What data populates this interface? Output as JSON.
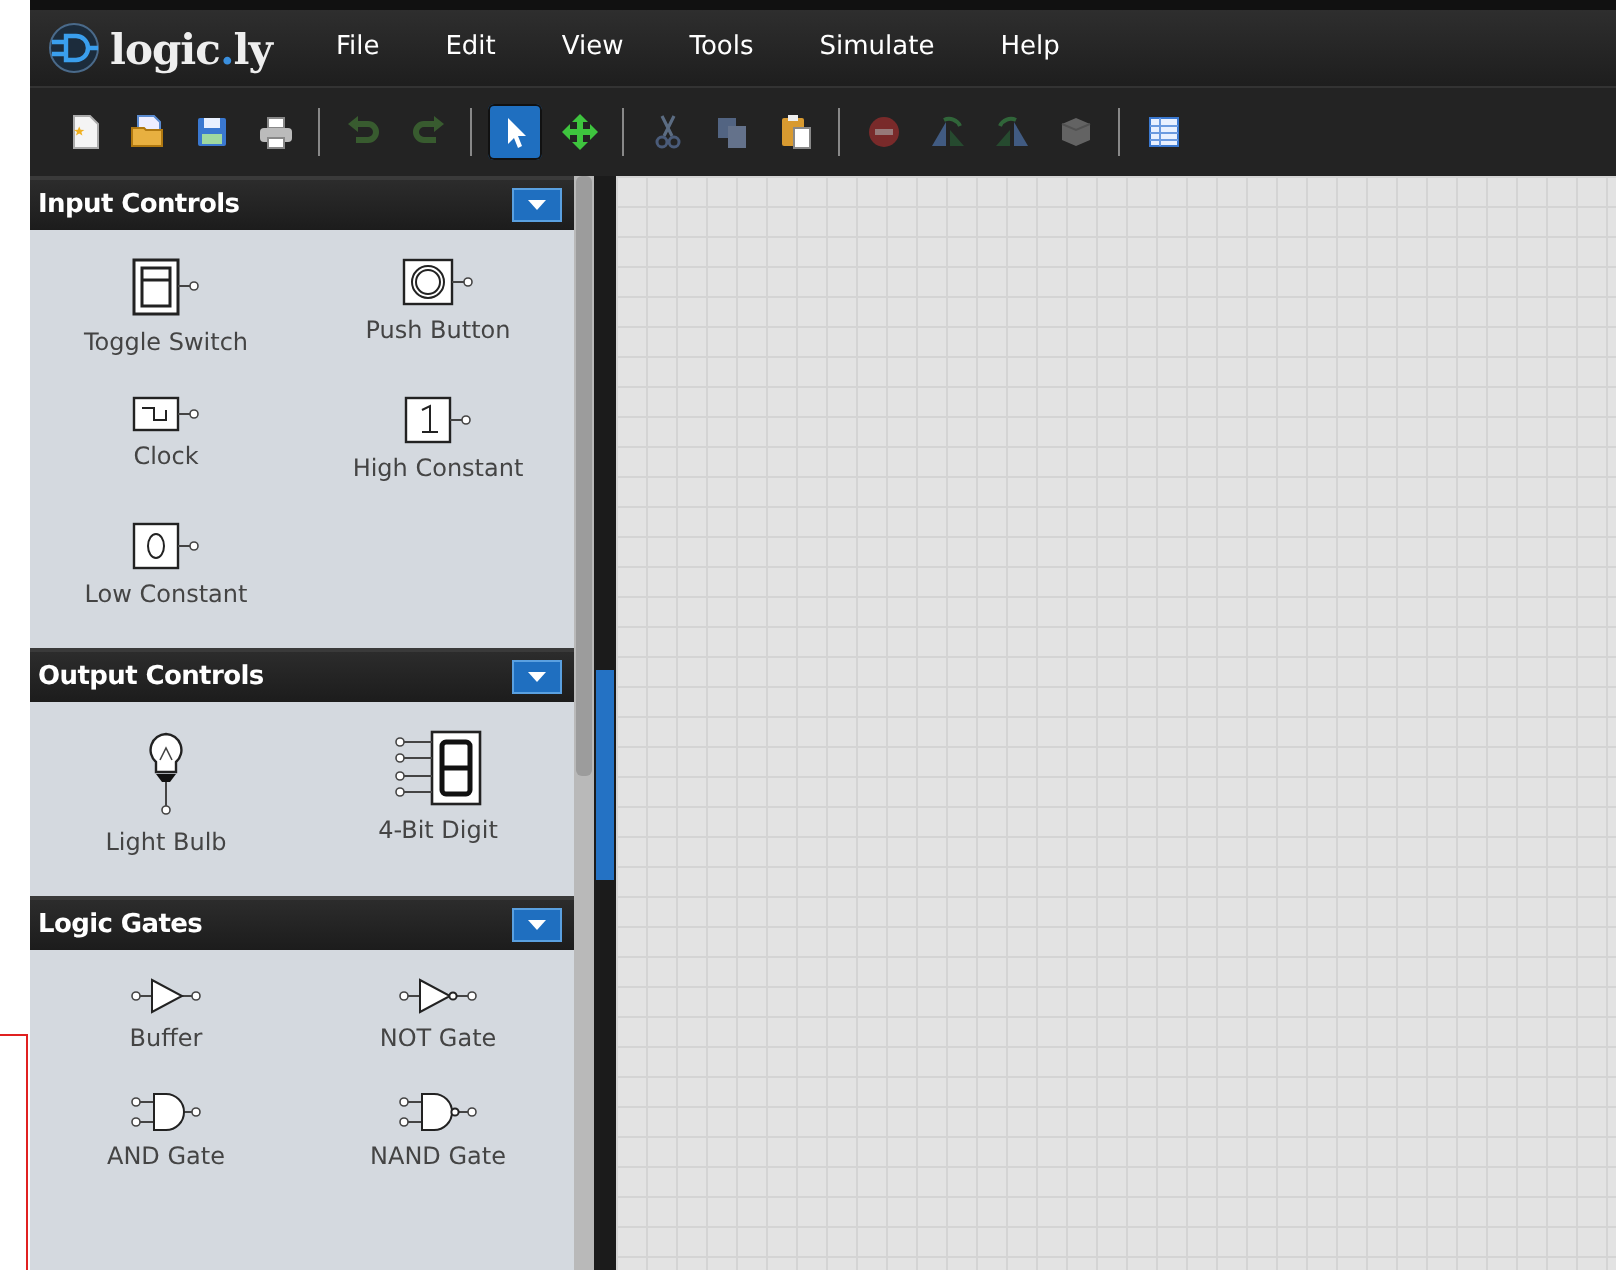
{
  "app": {
    "logo": "logic",
    "logo_dot": ".",
    "logo_tld": "ly"
  },
  "menu": [
    "File",
    "Edit",
    "View",
    "Tools",
    "Simulate",
    "Help"
  ],
  "toolbar": [
    [
      {
        "kind": "new",
        "selected": false,
        "disabled": false
      },
      {
        "kind": "open",
        "selected": false,
        "disabled": false
      },
      {
        "kind": "save",
        "selected": false,
        "disabled": false
      },
      {
        "kind": "print",
        "selected": false,
        "disabled": false
      }
    ],
    [
      {
        "kind": "undo",
        "selected": false,
        "disabled": true
      },
      {
        "kind": "redo",
        "selected": false,
        "disabled": true
      }
    ],
    [
      {
        "kind": "select",
        "selected": true,
        "disabled": false
      },
      {
        "kind": "move",
        "selected": false,
        "disabled": false
      }
    ],
    [
      {
        "kind": "cut",
        "selected": false,
        "disabled": true
      },
      {
        "kind": "copy",
        "selected": false,
        "disabled": true
      },
      {
        "kind": "paste",
        "selected": false,
        "disabled": false
      }
    ],
    [
      {
        "kind": "delete",
        "selected": false,
        "disabled": true
      },
      {
        "kind": "flip-left",
        "selected": false,
        "disabled": true
      },
      {
        "kind": "flip-right",
        "selected": false,
        "disabled": true
      },
      {
        "kind": "component",
        "selected": false,
        "disabled": true
      }
    ],
    [
      {
        "kind": "table",
        "selected": false,
        "disabled": false
      }
    ]
  ],
  "palette": [
    {
      "title": "Input Controls",
      "expanded": true,
      "items": [
        {
          "label": "Toggle Switch",
          "kind": "toggle"
        },
        {
          "label": "Push Button",
          "kind": "push"
        },
        {
          "label": "Clock",
          "kind": "clock"
        },
        {
          "label": "High Constant",
          "kind": "high"
        },
        {
          "label": "Low Constant",
          "kind": "low"
        }
      ]
    },
    {
      "title": "Output Controls",
      "expanded": true,
      "items": [
        {
          "label": "Light Bulb",
          "kind": "bulb"
        },
        {
          "label": "4-Bit Digit",
          "kind": "digit"
        }
      ]
    },
    {
      "title": "Logic Gates",
      "expanded": true,
      "items": [
        {
          "label": "Buffer",
          "kind": "buffer"
        },
        {
          "label": "NOT Gate",
          "kind": "not"
        },
        {
          "label": "AND Gate",
          "kind": "and"
        },
        {
          "label": "NAND Gate",
          "kind": "nand"
        }
      ]
    }
  ]
}
